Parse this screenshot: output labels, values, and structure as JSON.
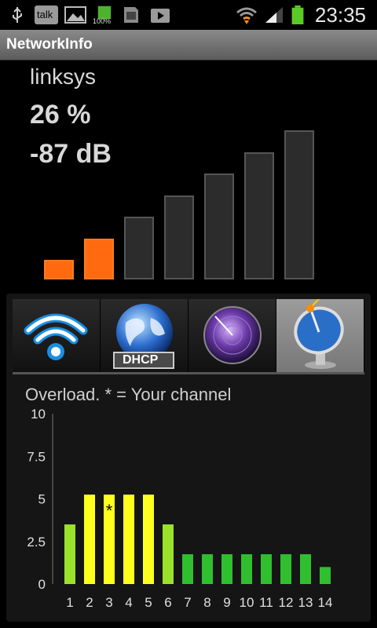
{
  "status_bar": {
    "time": "23:35",
    "icons": [
      "usb-icon",
      "talk-icon",
      "image-icon",
      "battery-100-icon",
      "sd-card-icon",
      "play-store-icon",
      "wifi-icon",
      "signal-icon",
      "battery-icon"
    ],
    "talk_label": "talk",
    "battery_label": "100%"
  },
  "app": {
    "title": "NetworkInfo"
  },
  "signal": {
    "ssid": "linksys",
    "percent": "26 %",
    "dbm": "-87 dB",
    "bars_total": 7,
    "bars_active": 2,
    "active_color": "#ff6a10"
  },
  "tabs": [
    {
      "name": "wifi",
      "icon": "wifi-icon",
      "label": "",
      "active": false
    },
    {
      "name": "dhcp",
      "icon": "globe-icon",
      "label": "DHCP",
      "active": false
    },
    {
      "name": "radar",
      "icon": "radar-icon",
      "label": "",
      "active": false
    },
    {
      "name": "channels",
      "icon": "satellite-dish-icon",
      "label": "",
      "active": true
    }
  ],
  "chart_title": "Overload. * = Your channel",
  "chart_data": {
    "type": "bar",
    "categories": [
      "1",
      "2",
      "3",
      "4",
      "5",
      "6",
      "7",
      "8",
      "9",
      "10",
      "11",
      "12",
      "13",
      "14"
    ],
    "values": [
      3.5,
      5.25,
      5.25,
      5.25,
      5.25,
      3.5,
      1.75,
      1.75,
      1.75,
      1.75,
      1.75,
      1.75,
      1.75,
      1.0
    ],
    "colors": [
      "#9be22a",
      "#ffff1e",
      "#ffff1e",
      "#ffff1e",
      "#ffff1e",
      "#9be22a",
      "#2fbf2f",
      "#2fbf2f",
      "#2fbf2f",
      "#2fbf2f",
      "#2fbf2f",
      "#2fbf2f",
      "#2fbf2f",
      "#2fbf2f"
    ],
    "your_channel": "3",
    "marker": "*",
    "yticks": [
      "10",
      "7.5",
      "5",
      "2.5",
      "0"
    ],
    "ylim": [
      0,
      10
    ],
    "grid": false
  }
}
